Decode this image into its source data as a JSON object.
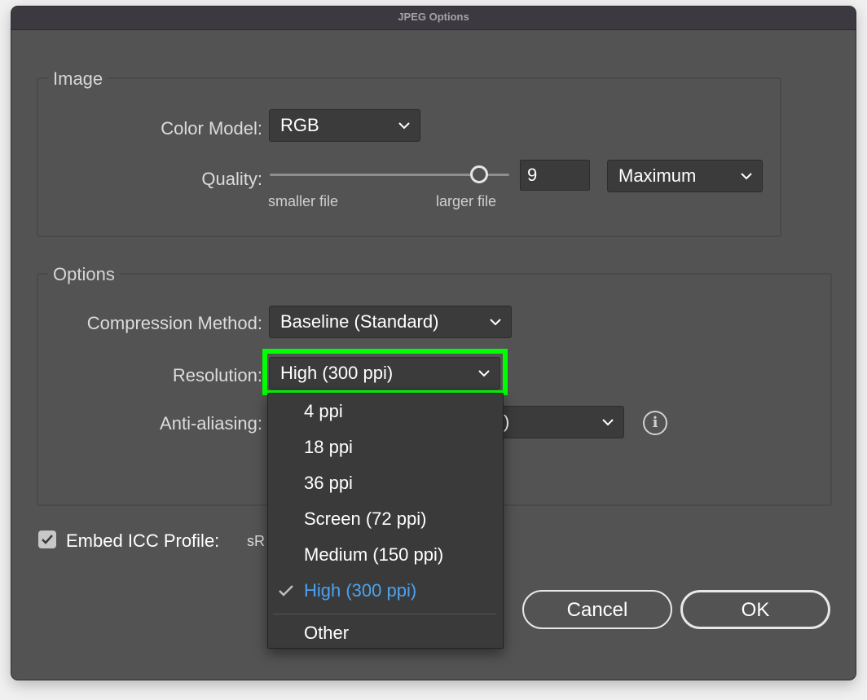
{
  "window": {
    "title": "JPEG Options"
  },
  "image_group": {
    "title": "Image",
    "color_model_label": "Color Model:",
    "color_model_value": "RGB",
    "quality_label": "Quality:",
    "quality_value": "9",
    "quality_preset": "Maximum",
    "slider_min_label": "smaller file",
    "slider_max_label": "larger file"
  },
  "options_group": {
    "title": "Options",
    "compression_label": "Compression Method:",
    "compression_value": "Baseline (Standard)",
    "resolution_label": "Resolution:",
    "resolution_value": "High (300 ppi)",
    "antialiasing_label": "Anti-aliasing:",
    "antialiasing_partial_value": ")"
  },
  "embed": {
    "label": "Embed ICC Profile:",
    "partial_value": "sR",
    "checked": true
  },
  "resolution_menu": {
    "items": [
      "4 ppi",
      "18 ppi",
      "36 ppi",
      "Screen (72 ppi)",
      "Medium (150 ppi)",
      "High (300 ppi)",
      "Other"
    ],
    "selected": "High (300 ppi)"
  },
  "buttons": {
    "cancel": "Cancel",
    "ok": "OK"
  },
  "colors": {
    "highlight": "#00ff00",
    "selected_item": "#4aa3f0",
    "dialog_bg": "#535353"
  }
}
